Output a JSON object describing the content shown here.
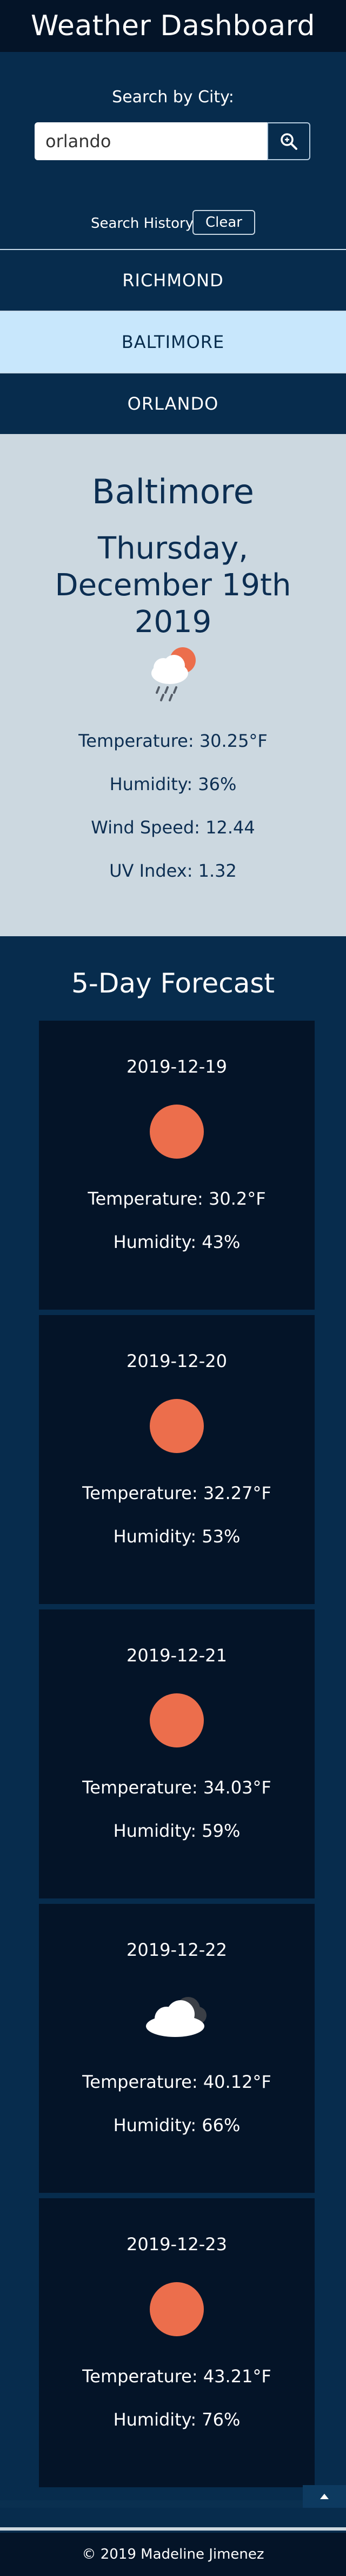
{
  "header": {
    "title": "Weather Dashboard"
  },
  "search": {
    "label": "Search by City:",
    "value": "orlando",
    "button_icon": "search-icon",
    "history_label": "Search History",
    "clear_label": "Clear"
  },
  "history": {
    "items": [
      {
        "label": "RICHMOND",
        "active": false
      },
      {
        "label": "BALTIMORE",
        "active": true
      },
      {
        "label": "ORLANDO",
        "active": false
      }
    ]
  },
  "current": {
    "city": "Baltimore",
    "date": "Thursday, December 19th 2019",
    "icon": "rain-cloud-sun-icon",
    "temperature": "Temperature: 30.25°F",
    "humidity": "Humidity: 36%",
    "wind": "Wind Speed: 12.44",
    "uv": "UV Index: 1.32"
  },
  "forecast": {
    "title": "5-Day Forecast",
    "days": [
      {
        "date": "2019-12-19",
        "icon": "sun-icon",
        "temperature": "Temperature: 30.2°F",
        "humidity": "Humidity: 43%"
      },
      {
        "date": "2019-12-20",
        "icon": "sun-icon",
        "temperature": "Temperature: 32.27°F",
        "humidity": "Humidity: 53%"
      },
      {
        "date": "2019-12-21",
        "icon": "sun-icon",
        "temperature": "Temperature: 34.03°F",
        "humidity": "Humidity: 59%"
      },
      {
        "date": "2019-12-22",
        "icon": "cloud-icon",
        "temperature": "Temperature: 40.12°F",
        "humidity": "Humidity: 66%"
      },
      {
        "date": "2019-12-23",
        "icon": "sun-icon",
        "temperature": "Temperature: 43.21°F",
        "humidity": "Humidity: 76%"
      }
    ]
  },
  "footer": {
    "text": "© 2019 Madeline Jimenez"
  },
  "colors": {
    "accent": "#ec6e4c",
    "navy": "#072c4d",
    "dark": "#041428",
    "light": "#ccd8e0",
    "active": "#c8e7fc"
  }
}
